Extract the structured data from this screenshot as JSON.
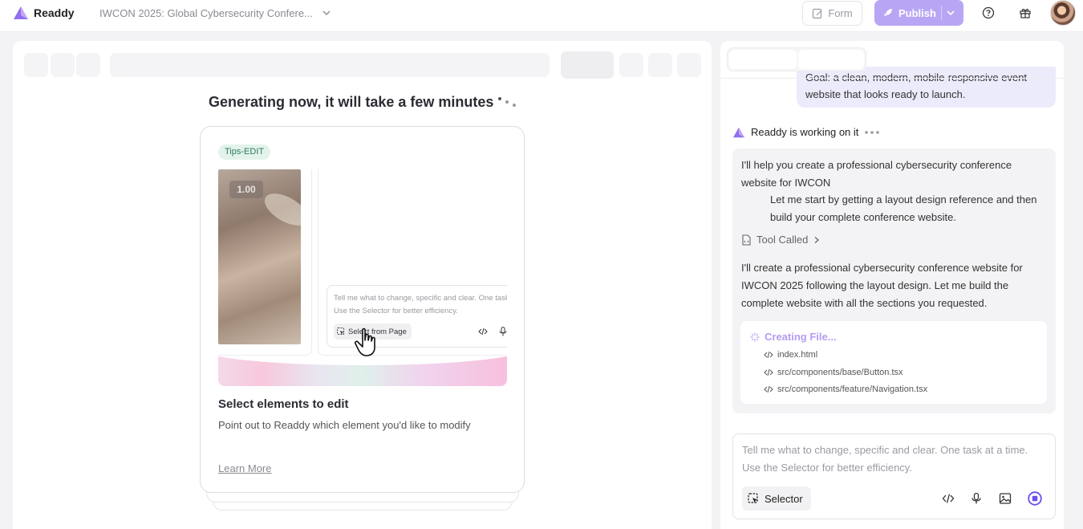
{
  "app": {
    "name": "Readdy",
    "project_title": "IWCON 2025: Global Cybersecurity Confere...",
    "colors": {
      "accent": "#b8a6f5",
      "accent_text": "#b59cf2",
      "tag_bg": "#e3f3ec",
      "tag_text": "#2d7a5c"
    }
  },
  "header": {
    "form_label": "Form",
    "publish_label": "Publish",
    "icons": [
      "help-icon",
      "gift-icon",
      "avatar"
    ]
  },
  "preview": {
    "generating_text": "Generating now, it will take a few minutes",
    "tip_card": {
      "tag": "Tips-EDIT",
      "speed": "1.00",
      "mini_placeholder_line1": "Tell me what to change, specific and clear. One task",
      "mini_placeholder_line2": "Use the Selector for better efficiency.",
      "mini_select_label": "Select from Page",
      "title": "Select elements to edit",
      "description": "Point out to Readdy which element you'd like to modify",
      "learn_more": "Learn More"
    }
  },
  "chat": {
    "user_message_line1": "Goal: a clean, modern, mobile-responsive event",
    "user_message_line2": "website that looks ready to launch.",
    "status": "Readdy is working on it",
    "assistant_p1_line1": "I'll help you create a professional cybersecurity conference",
    "assistant_p1_line2": "website for IWCON",
    "assistant_p2_line1": "Let me start by getting a layout design reference and then",
    "assistant_p2_line2": "build your complete conference website.",
    "tool_called": "Tool Called",
    "assistant_p3_line1": "I'll create a professional cybersecurity conference website for",
    "assistant_p3_line2": "IWCON 2025 following the layout design. Let me build the",
    "assistant_p3_line3": "complete website with all the sections you requested.",
    "creating_label": "Creating File...",
    "files": [
      "index.html",
      "src/components/base/Button.tsx",
      "src/components/feature/Navigation.tsx"
    ],
    "input": {
      "placeholder_line1": "Tell me what to change, specific and clear. One task at a time.",
      "placeholder_line2": "Use the Selector for better efficiency.",
      "selector_label": "Selector"
    }
  }
}
